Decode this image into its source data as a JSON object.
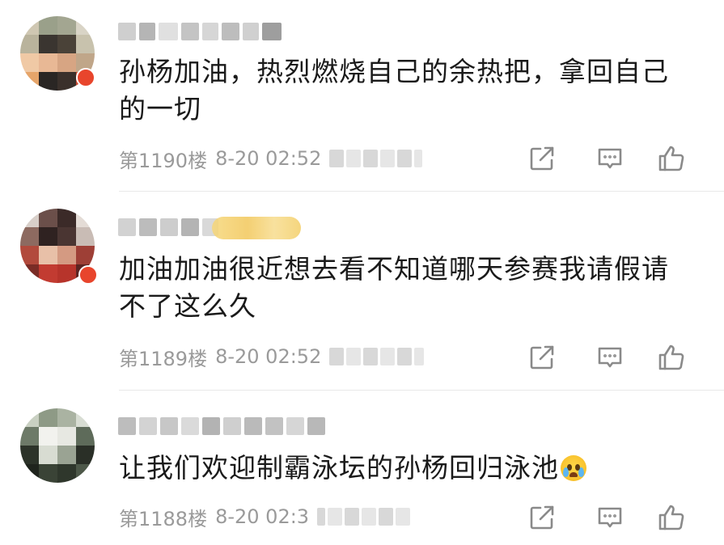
{
  "comments": [
    {
      "content_line1": "孙杨加油，热烈燃烧自己的余热把，拿回自己",
      "content_line2": "的一切",
      "floor": "第1190楼",
      "time": "8-20 02:52",
      "has_badge": true
    },
    {
      "content_line1": "加油加油很近想去看不知道哪天参赛我请假请",
      "content_line2": "不了这么久",
      "floor": "第1189楼",
      "time": "8-20 02:52",
      "has_badge": true,
      "has_vip_badge": true
    },
    {
      "content_line1": "让我们欢迎制霸泳坛的孙杨回归泳池",
      "floor": "第1188楼",
      "time": "8-20 02:3",
      "emoji": "crying-face-emoji"
    }
  ],
  "icons": {
    "share": "share-icon",
    "reply": "reply-icon",
    "like": "thumbs-up-icon"
  },
  "colors": {
    "text": "#1a1a1a",
    "meta": "#9a9a9a",
    "icon": "#8a8a8a",
    "divider": "#e8e8e8",
    "badge": "#e8452c",
    "vip": "#f2c75a"
  }
}
